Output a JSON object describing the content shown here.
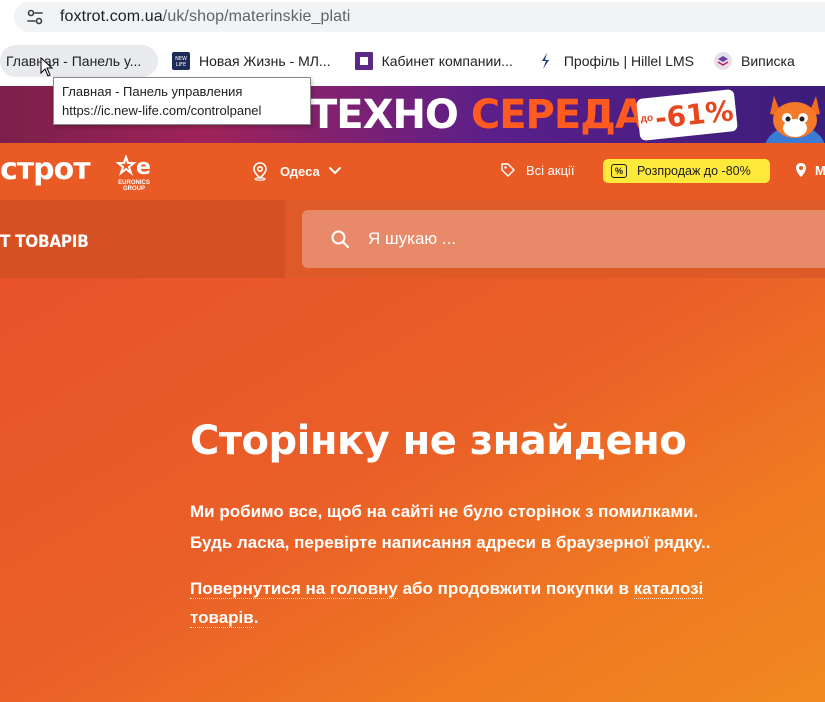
{
  "browser": {
    "url_host": "foxtrot.com.ua",
    "url_path": "/uk/shop/materinskie_plati",
    "bookmarks": [
      {
        "label": "Главная - Панель у...",
        "icon": "blank-page-icon",
        "active": true
      },
      {
        "label": "Новая Жизнь - МЛ...",
        "icon": "newlife-icon"
      },
      {
        "label": "Кабинет компании...",
        "icon": "purple-square-icon"
      },
      {
        "label": "Профіль | Hillel LMS",
        "icon": "hillel-icon"
      },
      {
        "label": "Виписка",
        "icon": "layers-icon"
      }
    ],
    "tooltip": {
      "title": "Главная - Панель управления",
      "url": "https://ic.new-life.com/controlpanel"
    }
  },
  "banner": {
    "word1": "ТЕХНО",
    "word2": "СЕРЕДА",
    "badge_prefix": "до",
    "badge_value": "-61%"
  },
  "header": {
    "logo_text": "строт",
    "logo_group": "EURONICS GROUP",
    "city": "Одеса",
    "promos_label": "Всі акції",
    "sale_label": "Розпродаж до -80%",
    "stores_label": "М"
  },
  "subheader": {
    "catalog_label": "Т ТОВАРІВ",
    "search_placeholder": "Я шукаю ..."
  },
  "main": {
    "title": "Сторінку не знайдено",
    "line1": "Ми робимо все, щоб на сайті не було сторінок з помилками.",
    "line2": "Будь ласка, перевірте написання адреси в браузерної рядку..",
    "link_home": "Повернутися на головну",
    "link_between": " або продовжити покупки в ",
    "link_catalog_1": "каталозі",
    "link_catalog_2": "товарів",
    "link_end": "."
  },
  "colors": {
    "brand_orange": "#ea5a24",
    "sale_yellow": "#ffe93b"
  }
}
